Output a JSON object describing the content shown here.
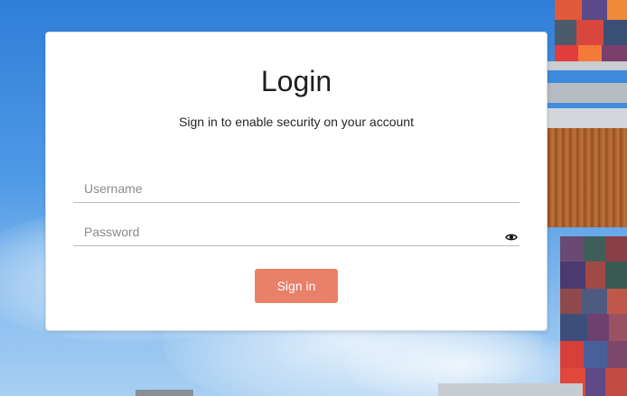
{
  "login": {
    "title": "Login",
    "subtitle": "Sign in to enable security on your account",
    "username_placeholder": "Username",
    "username_value": "",
    "password_placeholder": "Password",
    "password_value": "",
    "show_password_icon": "eye-icon",
    "signin_label": "Sign in"
  },
  "colors": {
    "accent_button": "#e9806a",
    "card_background": "#ffffff",
    "sky": "#3f8ee0"
  }
}
